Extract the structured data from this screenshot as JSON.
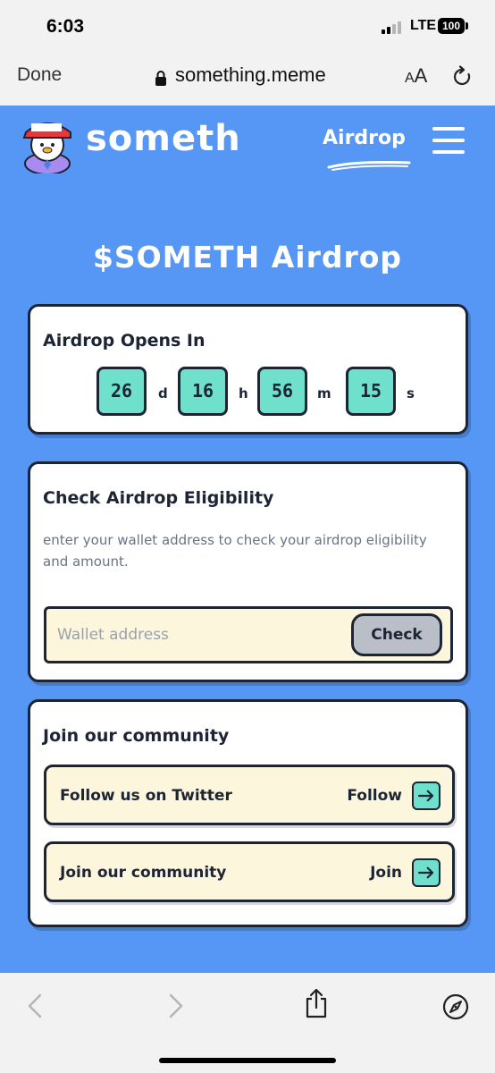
{
  "status_bar": {
    "time": "6:03",
    "network": "LTE",
    "battery": "100"
  },
  "browser": {
    "done_label": "Done",
    "url": "something.meme",
    "aa_small": "A",
    "aa_big": "A"
  },
  "header": {
    "brand": "someth",
    "nav_label": "Airdrop",
    "logo_cap_text": "Believe in someThing"
  },
  "page_title": "$SOMETH Airdrop",
  "countdown": {
    "title": "Airdrop Opens In",
    "days": "26",
    "days_unit": "d",
    "hours": "16",
    "hours_unit": "h",
    "minutes": "56",
    "minutes_unit": "m",
    "seconds": "15",
    "seconds_unit": "s"
  },
  "eligibility": {
    "title": "Check Airdrop Eligibility",
    "description": "enter your wallet address to check your airdrop eligibility and amount.",
    "input_placeholder": "Wallet address",
    "input_value": "",
    "button_label": "Check"
  },
  "community": {
    "title": "Join our community",
    "items": [
      {
        "label": "Follow us on Twitter",
        "action": "Follow"
      },
      {
        "label": "Join our community",
        "action": "Join"
      }
    ]
  },
  "colors": {
    "background": "#5696f4",
    "accent": "#6ee0cb",
    "card": "#ffffff",
    "input_bg": "#fcf6dd",
    "ink": "#1d2433"
  },
  "icons": [
    "lock-icon",
    "reload-icon",
    "hamburger-icon",
    "arrow-right-icon",
    "back-icon",
    "forward-icon",
    "share-icon",
    "compass-icon"
  ]
}
